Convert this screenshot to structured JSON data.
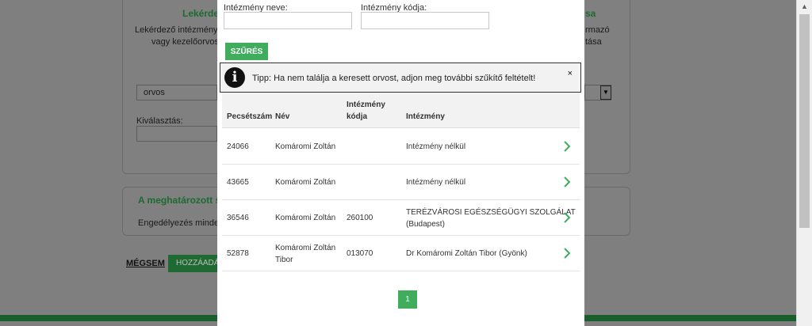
{
  "background": {
    "panel1_title": "Lekérdez",
    "panel1_title_right": "sa",
    "panel1_line1": "Lekérdező intézmény, sz",
    "panel1_line2": "vagy kezelőorvos k",
    "panel1_right1": "rmazó",
    "panel1_right2": "tása",
    "select_value": "orvos",
    "select_label": "Kiválasztás:",
    "panel2_title": "A meghatározott sz",
    "panel2_text": "Engedélyezés minden lel",
    "cancel_link": "MÉGSEM",
    "add_button": "HOZZÁADÁS"
  },
  "modal": {
    "institution_name_label": "Intézmény neve:",
    "institution_name_value": "",
    "institution_code_label": "Intézmény kódja:",
    "institution_code_value": "",
    "filter_button": "SZŰRÉS",
    "tip_icon_glyph": "i",
    "tip_text": "Tipp: Ha nem találja a keresett orvost, adjon meg további szűkítő feltételt!",
    "tip_close": "×",
    "columns": {
      "stamp": "Pecsétszám",
      "name": "Név",
      "code_line1": "Intézmény",
      "code_line2": "kódja",
      "institution": "Intézmény"
    },
    "rows": [
      {
        "stamp": "24066",
        "name1": "Komáromi Zoltán",
        "name2": "",
        "code": "",
        "inst1": "Intézmény nélkül",
        "inst2": ""
      },
      {
        "stamp": "43665",
        "name1": "Komáromi Zoltán",
        "name2": "",
        "code": "",
        "inst1": "Intézmény nélkül",
        "inst2": ""
      },
      {
        "stamp": "36546",
        "name1": "Komáromi Zoltán",
        "name2": "",
        "code": "260100",
        "inst1": "TERÉZVÁROSI EGÉSZSÉGÜGYI SZOLGÁLAT",
        "inst2": "(Budapest)"
      },
      {
        "stamp": "52878",
        "name1": "Komáromi Zoltán",
        "name2": "Tibor",
        "code": "013070",
        "inst1": "Dr Komáromi Zoltán Tibor (Gyönk)",
        "inst2": ""
      }
    ],
    "page_number": "1"
  },
  "colors": {
    "accent_green": "#3fad5c",
    "overlay_gray": "#7f7f7f"
  }
}
